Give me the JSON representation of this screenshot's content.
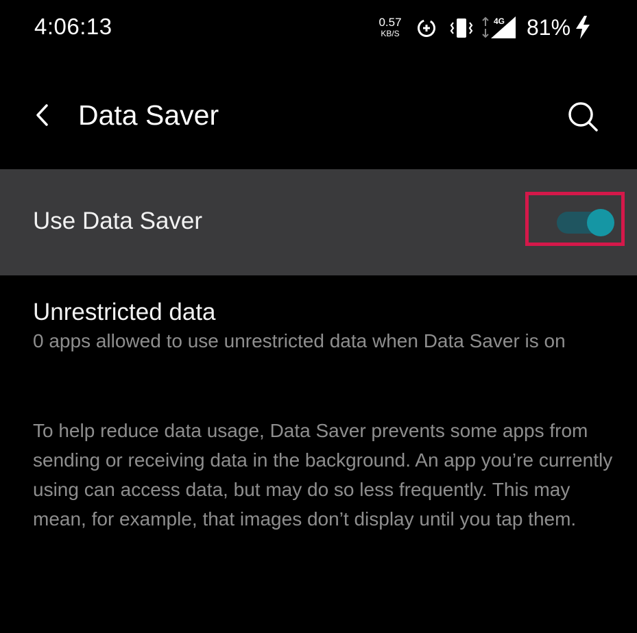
{
  "status_bar": {
    "time": "4:06:13",
    "net_speed_value": "0.57",
    "net_speed_unit": "KB/S",
    "network_type": "4G",
    "battery_percent": "81%",
    "icons": [
      "data-saver-status-icon",
      "vibrate-icon",
      "signal-icon",
      "charging-icon"
    ]
  },
  "app_bar": {
    "title": "Data Saver",
    "back_icon": "chevron-left-icon",
    "search_icon": "search-icon"
  },
  "data_saver": {
    "label": "Use Data Saver",
    "enabled": true
  },
  "unrestricted": {
    "title": "Unrestricted data",
    "summary": "0 apps allowed to use unrestricted data when Data Saver is on"
  },
  "footer": {
    "description": "To help reduce data usage, Data Saver prevents some apps from sending or receiving data in the background. An app you’re currently using can access data, but may do so less frequently. This may mean, for example, that images don’t display until you tap them."
  },
  "colors": {
    "background": "#000000",
    "row_background": "#3a3a3c",
    "toggle_accent": "#1596a4",
    "highlight_border": "#d4184a",
    "secondary_text": "#8e8e8e"
  }
}
